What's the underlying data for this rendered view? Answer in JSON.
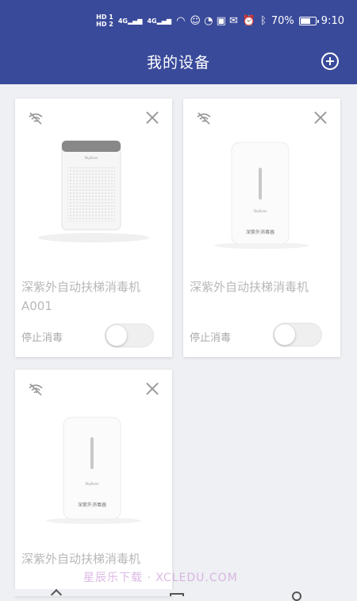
{
  "status_bar": {
    "hd1": "HD 1",
    "hd2": "HD 2",
    "net1": "4G",
    "net2": "4G",
    "battery_percent": 70,
    "battery_label": "70%",
    "time": "9:10"
  },
  "header": {
    "title": "我的设备",
    "add_icon": "plus-circle-icon"
  },
  "devices": [
    {
      "name": "深紫外自动扶梯消毒机 A001",
      "status": "停止消毒",
      "toggle_on": false,
      "image": "air-purifier",
      "image_brand": "SkyEvon",
      "image_caption": ""
    },
    {
      "name": "深紫外自动扶梯消毒机",
      "status": "停止消毒",
      "toggle_on": false,
      "image": "disinfector",
      "image_brand": "SkyEvon",
      "image_caption": "深紫外消毒器"
    },
    {
      "name": "深紫外自动扶梯消毒机",
      "status": "",
      "toggle_on": false,
      "image": "disinfector",
      "image_brand": "SkyEvon",
      "image_caption": "深紫外消毒器"
    }
  ],
  "watermark": "星辰乐下载 · XCLEDU.COM",
  "colors": {
    "header_bg": "#3a4a9a",
    "page_bg": "#eef0f3",
    "muted_text": "#b8b8b8"
  }
}
